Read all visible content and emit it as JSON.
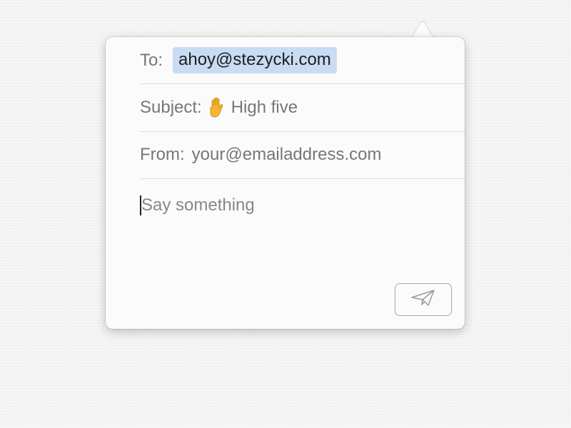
{
  "compose": {
    "to_label": "To:",
    "to_recipient": "ahoy@stezycki.com",
    "subject_label": "Subject:",
    "subject_emoji": "raised-hand-icon",
    "subject_text": "High five",
    "from_label": "From:",
    "from_placeholder": "your@emailaddress.com",
    "message_placeholder": "Say something",
    "send_icon": "paper-plane-icon"
  },
  "colors": {
    "background": "#f6f6f6",
    "popover": "#fbfbfb",
    "recipient_token": "#c8dcf3",
    "divider": "#dcdcdc",
    "text_muted": "#777777"
  }
}
